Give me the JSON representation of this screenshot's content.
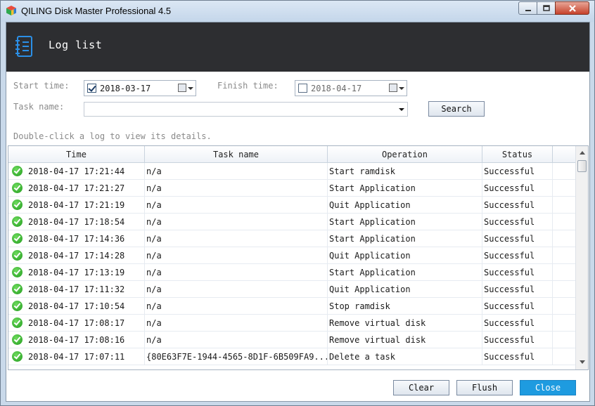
{
  "window": {
    "title": "QILING Disk Master Professional 4.5"
  },
  "header": {
    "title": "Log list",
    "icon": "log-list-icon"
  },
  "filters": {
    "start_label": "Start time:",
    "start_date": "2018-03-17",
    "start_checked": true,
    "finish_label": "Finish time:",
    "finish_date": "2018-04-17",
    "finish_checked": false,
    "task_label": "Task name:",
    "task_value": "",
    "search_label": "Search"
  },
  "hint": "Double-click a log to view its details.",
  "table": {
    "columns": [
      "Time",
      "Task name",
      "Operation",
      "Status"
    ],
    "rows": [
      {
        "time": "2018-04-17 17:21:44",
        "task": "n/a",
        "operation": "Start ramdisk",
        "status": "Successful"
      },
      {
        "time": "2018-04-17 17:21:27",
        "task": "n/a",
        "operation": "Start Application",
        "status": "Successful"
      },
      {
        "time": "2018-04-17 17:21:19",
        "task": "n/a",
        "operation": "Quit Application",
        "status": "Successful"
      },
      {
        "time": "2018-04-17 17:18:54",
        "task": "n/a",
        "operation": "Start Application",
        "status": "Successful"
      },
      {
        "time": "2018-04-17 17:14:36",
        "task": "n/a",
        "operation": "Start Application",
        "status": "Successful"
      },
      {
        "time": "2018-04-17 17:14:28",
        "task": "n/a",
        "operation": "Quit Application",
        "status": "Successful"
      },
      {
        "time": "2018-04-17 17:13:19",
        "task": "n/a",
        "operation": "Start Application",
        "status": "Successful"
      },
      {
        "time": "2018-04-17 17:11:32",
        "task": "n/a",
        "operation": "Quit Application",
        "status": "Successful"
      },
      {
        "time": "2018-04-17 17:10:54",
        "task": "n/a",
        "operation": "Stop ramdisk",
        "status": "Successful"
      },
      {
        "time": "2018-04-17 17:08:17",
        "task": "n/a",
        "operation": "Remove virtual disk",
        "status": "Successful"
      },
      {
        "time": "2018-04-17 17:08:16",
        "task": "n/a",
        "operation": "Remove virtual disk",
        "status": "Successful"
      },
      {
        "time": "2018-04-17 17:07:11",
        "task": "{80E63F7E-1944-4565-8D1F-6B509FA9...",
        "operation": "Delete a task",
        "status": "Successful"
      }
    ]
  },
  "footer": {
    "clear_label": "Clear",
    "flush_label": "Flush",
    "close_label": "Close"
  },
  "colors": {
    "header_bg": "#2d2e31",
    "accent": "#1e9be0",
    "success": "#2aa52a"
  }
}
